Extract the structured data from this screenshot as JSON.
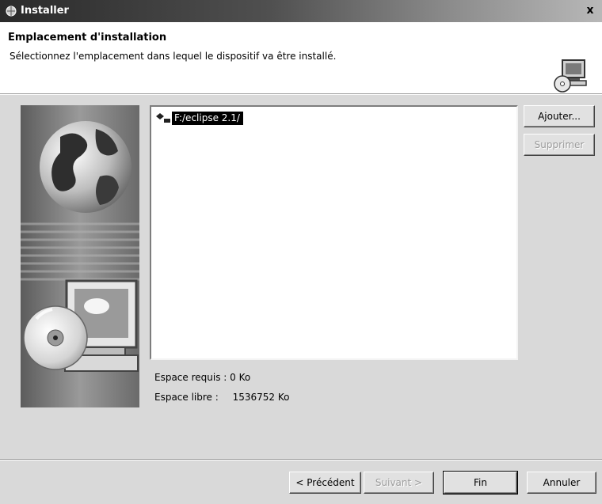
{
  "window": {
    "title": "Installer",
    "close_glyph": "x",
    "app_icon": "installer-icon"
  },
  "header": {
    "title": "Emplacement d'installation",
    "description": "Sélectionnez l'emplacement dans lequel le dispositif va être installé.",
    "icon": "computer-cd-icon"
  },
  "sidebar_art": {
    "icons": [
      "globe-icon",
      "monitor-icon",
      "cd-icon"
    ]
  },
  "location_list": {
    "items": [
      {
        "label": "F:/eclipse 2.1/",
        "icon": "folder-location-icon",
        "selected": true
      }
    ]
  },
  "side_buttons": {
    "add_label": "Ajouter...",
    "remove_label": "Supprimer"
  },
  "space": {
    "required_label": "Espace requis :",
    "required_value": "0 Ko",
    "free_label": "Espace libre :",
    "free_value": "1536752 Ko"
  },
  "footer_buttons": {
    "previous_label": "< Précédent",
    "next_label": "Suivant >",
    "finish_label": "Fin",
    "cancel_label": "Annuler"
  }
}
